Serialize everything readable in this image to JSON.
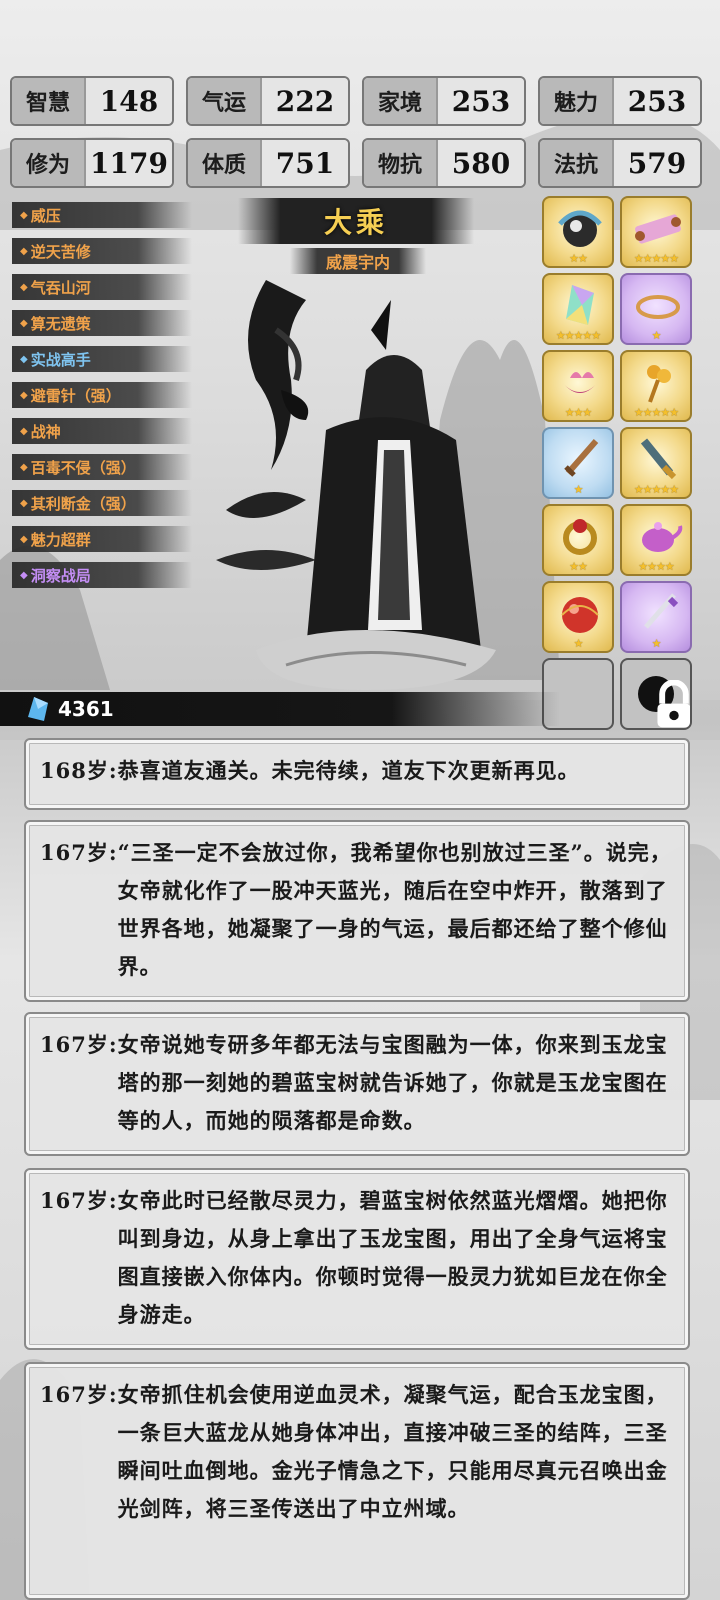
{
  "stats": [
    {
      "label": "智慧",
      "value": "148"
    },
    {
      "label": "气运",
      "value": "222"
    },
    {
      "label": "家境",
      "value": "253"
    },
    {
      "label": "魅力",
      "value": "253"
    },
    {
      "label": "修为",
      "value": "1179"
    },
    {
      "label": "体质",
      "value": "751"
    },
    {
      "label": "物抗",
      "value": "580"
    },
    {
      "label": "法抗",
      "value": "579"
    }
  ],
  "skills": [
    {
      "label": "威压",
      "color": "orange"
    },
    {
      "label": "逆天苦修",
      "color": "orange"
    },
    {
      "label": "气吞山河",
      "color": "orange"
    },
    {
      "label": "算无遗策",
      "color": "orange"
    },
    {
      "label": "实战高手",
      "color": "blue"
    },
    {
      "label": "避雷针（强）",
      "color": "orange"
    },
    {
      "label": "战神",
      "color": "orange"
    },
    {
      "label": "百毒不侵（强）",
      "color": "orange"
    },
    {
      "label": "其利断金（强）",
      "color": "orange"
    },
    {
      "label": "魅力超群",
      "color": "orange"
    },
    {
      "label": "洞察战局",
      "color": "purple"
    }
  ],
  "realm": {
    "title": "大乘",
    "subtitle": "威震宇内"
  },
  "items": [
    {
      "icon": "dark-orb-icon",
      "rarity": "gold",
      "stars": 2
    },
    {
      "icon": "scroll-icon",
      "rarity": "gold",
      "stars": 5
    },
    {
      "icon": "rainbow-crystal-icon",
      "rarity": "gold",
      "stars": 5
    },
    {
      "icon": "golden-ring-icon",
      "rarity": "purple",
      "stars": 1
    },
    {
      "icon": "lotus-bowl-icon",
      "rarity": "gold",
      "stars": 3
    },
    {
      "icon": "golden-ginseng-icon",
      "rarity": "gold",
      "stars": 5
    },
    {
      "icon": "wooden-sword-icon",
      "rarity": "blue",
      "stars": 1
    },
    {
      "icon": "jade-blade-icon",
      "rarity": "gold",
      "stars": 5
    },
    {
      "icon": "ruby-ring-icon",
      "rarity": "gold",
      "stars": 2
    },
    {
      "icon": "purple-teapot-icon",
      "rarity": "gold",
      "stars": 4
    },
    {
      "icon": "red-pearl-icon",
      "rarity": "gold",
      "stars": 1
    },
    {
      "icon": "purple-sword-icon",
      "rarity": "purple",
      "stars": 1
    }
  ],
  "currency": {
    "icon": "blue-crystal-icon",
    "amount": "4361"
  },
  "logs": [
    {
      "age": "168岁:",
      "text": "恭喜道友通关。未完待续，道友下次更新再见。"
    },
    {
      "age": "167岁:",
      "text": "“三圣一定不会放过你，我希望你也别放过三圣”。说完，女帝就化作了一股冲天蓝光，随后在空中炸开，散落到了世界各地，她凝聚了一身的气运，最后都还给了整个修仙界。"
    },
    {
      "age": "167岁:",
      "text": "女帝说她专研多年都无法与宝图融为一体，你来到玉龙宝塔的那一刻她的碧蓝宝树就告诉她了，你就是玉龙宝图在等的人，而她的陨落都是命数。"
    },
    {
      "age": "167岁:",
      "text": "女帝此时已经散尽灵力，碧蓝宝树依然蓝光熠熠。她把你叫到身边，从身上拿出了玉龙宝图，用出了全身气运将宝图直接嵌入你体内。你顿时觉得一股灵力犹如巨龙在你全身游走。"
    },
    {
      "age": "167岁:",
      "text": "女帝抓住机会使用逆血灵术，凝聚气运，配合玉龙宝图，一条巨大蓝龙从她身体冲出，直接冲破三圣的结阵，三圣瞬间吐血倒地。金光子情急之下，只能用尽真元召唤出金光剑阵，将三圣传送出了中立州域。"
    }
  ],
  "colors": {
    "skill_orange": "#f0a24a",
    "skill_blue": "#7fc4f0",
    "skill_purple": "#c48ef5",
    "realm_gold": "#f6cf53"
  }
}
